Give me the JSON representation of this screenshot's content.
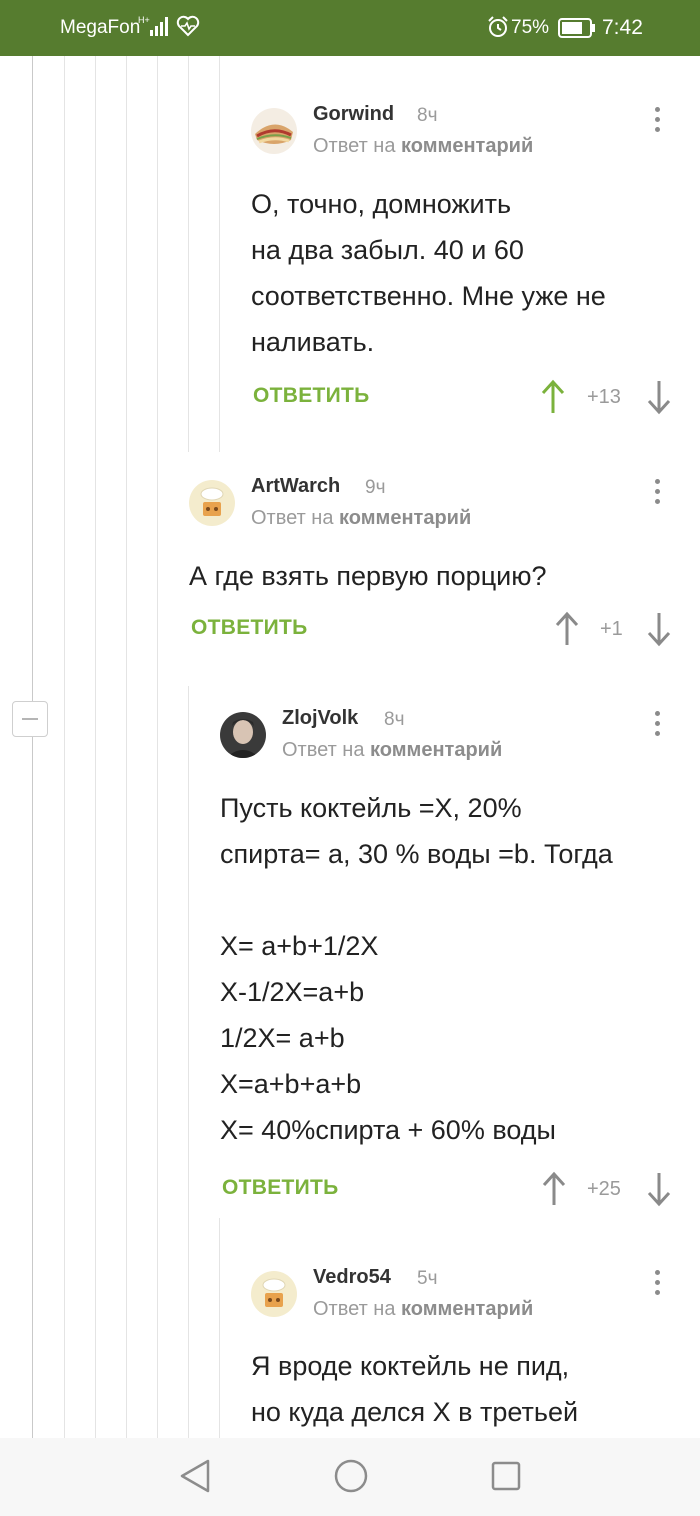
{
  "status_bar": {
    "carrier": "MegaFon",
    "battery": "75%",
    "time": "7:42"
  },
  "comments": [
    {
      "author": "Gorwind",
      "time": "8ч",
      "reply_prefix": "Ответ на",
      "reply_target": "комментарий",
      "body": "О, точно, домножить\nна два забыл. 40 и 60\nсоответственно. Мне уже не\nналивать.",
      "reply_label": "ОТВЕТИТЬ",
      "rating": "+13",
      "upvoted": true
    },
    {
      "author": "ArtWarch",
      "time": "9ч",
      "reply_prefix": "Ответ на",
      "reply_target": "комментарий",
      "body": "А где взять первую порцию?",
      "reply_label": "ОТВЕТИТЬ",
      "rating": "+1",
      "upvoted": false
    },
    {
      "author": "ZlojVolk",
      "time": "8ч",
      "reply_prefix": "Ответ на",
      "reply_target": "комментарий",
      "body": "Пусть коктейль =Х, 20%\nспирта= а, 30 % воды =b. Тогда\n\nХ= а+b+1/2Х\nХ-1/2Х=а+b\n1/2Х= а+b\nХ=а+b+а+b\nХ= 40%спирта + 60% воды",
      "reply_label": "ОТВЕТИТЬ",
      "rating": "+25",
      "upvoted": false
    },
    {
      "author": "Vedro54",
      "time": "5ч",
      "reply_prefix": "Ответ на",
      "reply_target": "комментарий",
      "body": "Я вроде коктейль не пид,\nно куда делся Х в третьей",
      "reply_label": "",
      "rating": "",
      "upvoted": false
    }
  ],
  "colors": {
    "status_bar": "#567c2f",
    "accent_green": "#7bb23c",
    "muted": "#9a9a9a"
  },
  "icons": [
    "signal-icon",
    "heart-rate-icon",
    "alarm-icon",
    "battery-icon",
    "kebab-menu-icon",
    "upvote-arrow-icon",
    "downvote-arrow-icon",
    "collapse-thread-icon",
    "nav-back-icon",
    "nav-home-icon",
    "nav-recent-icon"
  ]
}
